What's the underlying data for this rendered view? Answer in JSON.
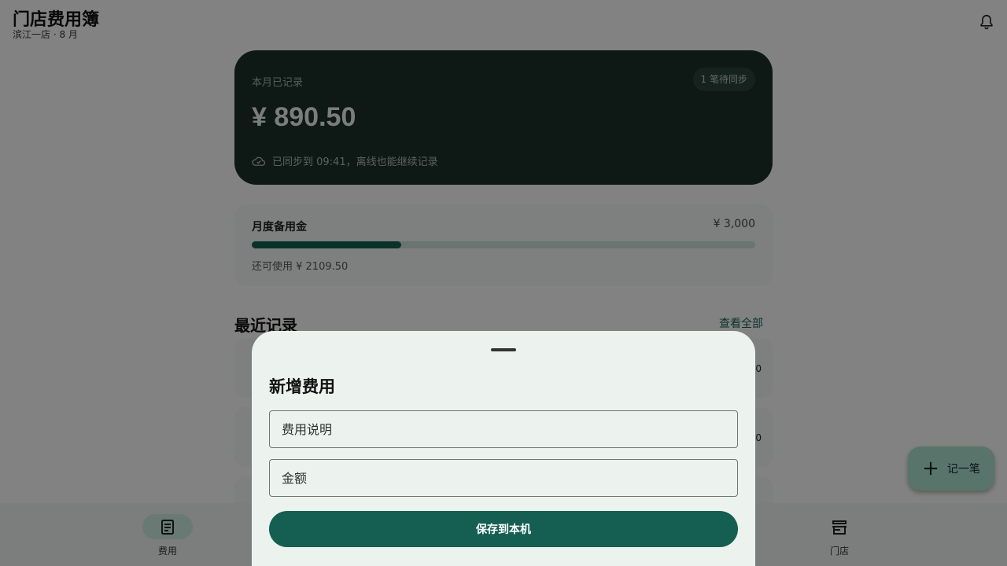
{
  "header": {
    "title": "门店费用簿",
    "subtitle": "滨江一店 · 8 月",
    "notification_icon": "bell-icon"
  },
  "hero": {
    "label": "本月已记录",
    "badge": "1 笔待同步",
    "amount": "¥ 890.50",
    "sync_icon": "cloud-check-icon",
    "sync_text": "已同步到 09:41，离线也能继续记录"
  },
  "budget": {
    "title": "月度备用金",
    "total": "¥ 3,000",
    "used_fraction": 0.2968,
    "remaining": "还可使用 ¥ 2109.50"
  },
  "recent": {
    "title": "最近记录",
    "view_all": "查看全部",
    "rows": [
      {
        "amount": "0"
      },
      {
        "amount": "0"
      }
    ]
  },
  "fab": {
    "icon": "plus-icon",
    "label": "记一笔"
  },
  "bottom_nav": {
    "items": [
      {
        "label": "费用",
        "icon": "receipt-icon",
        "active": true
      },
      {
        "label": "门店",
        "icon": "store-icon",
        "active": false
      }
    ]
  },
  "sheet": {
    "title": "新增费用",
    "description_placeholder": "费用说明",
    "amount_placeholder": "金额",
    "save_label": "保存到本机"
  },
  "colors": {
    "primary": "#145f51",
    "hero_bg": "#1b302b",
    "fab_bg": "#a9dcc9",
    "scrim": "#000000"
  }
}
